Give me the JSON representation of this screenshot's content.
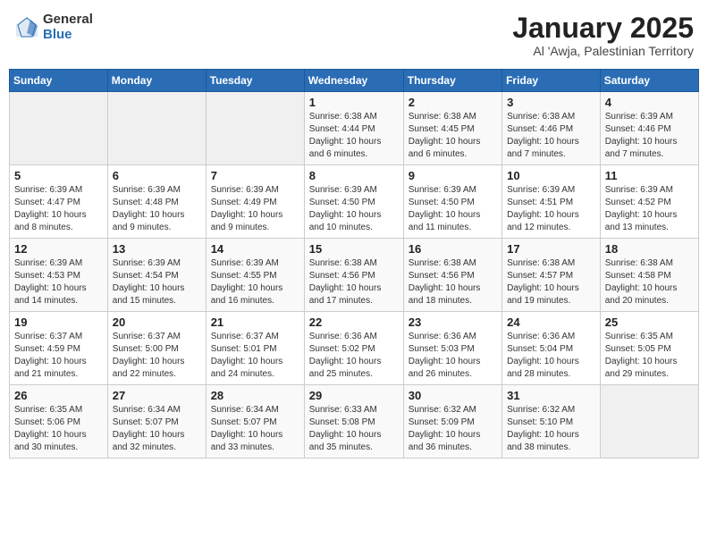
{
  "header": {
    "logo_general": "General",
    "logo_blue": "Blue",
    "month_title": "January 2025",
    "subtitle": "Al 'Awja, Palestinian Territory"
  },
  "weekdays": [
    "Sunday",
    "Monday",
    "Tuesday",
    "Wednesday",
    "Thursday",
    "Friday",
    "Saturday"
  ],
  "weeks": [
    [
      {
        "day": "",
        "info": ""
      },
      {
        "day": "",
        "info": ""
      },
      {
        "day": "",
        "info": ""
      },
      {
        "day": "1",
        "info": "Sunrise: 6:38 AM\nSunset: 4:44 PM\nDaylight: 10 hours\nand 6 minutes."
      },
      {
        "day": "2",
        "info": "Sunrise: 6:38 AM\nSunset: 4:45 PM\nDaylight: 10 hours\nand 6 minutes."
      },
      {
        "day": "3",
        "info": "Sunrise: 6:38 AM\nSunset: 4:46 PM\nDaylight: 10 hours\nand 7 minutes."
      },
      {
        "day": "4",
        "info": "Sunrise: 6:39 AM\nSunset: 4:46 PM\nDaylight: 10 hours\nand 7 minutes."
      }
    ],
    [
      {
        "day": "5",
        "info": "Sunrise: 6:39 AM\nSunset: 4:47 PM\nDaylight: 10 hours\nand 8 minutes."
      },
      {
        "day": "6",
        "info": "Sunrise: 6:39 AM\nSunset: 4:48 PM\nDaylight: 10 hours\nand 9 minutes."
      },
      {
        "day": "7",
        "info": "Sunrise: 6:39 AM\nSunset: 4:49 PM\nDaylight: 10 hours\nand 9 minutes."
      },
      {
        "day": "8",
        "info": "Sunrise: 6:39 AM\nSunset: 4:50 PM\nDaylight: 10 hours\nand 10 minutes."
      },
      {
        "day": "9",
        "info": "Sunrise: 6:39 AM\nSunset: 4:50 PM\nDaylight: 10 hours\nand 11 minutes."
      },
      {
        "day": "10",
        "info": "Sunrise: 6:39 AM\nSunset: 4:51 PM\nDaylight: 10 hours\nand 12 minutes."
      },
      {
        "day": "11",
        "info": "Sunrise: 6:39 AM\nSunset: 4:52 PM\nDaylight: 10 hours\nand 13 minutes."
      }
    ],
    [
      {
        "day": "12",
        "info": "Sunrise: 6:39 AM\nSunset: 4:53 PM\nDaylight: 10 hours\nand 14 minutes."
      },
      {
        "day": "13",
        "info": "Sunrise: 6:39 AM\nSunset: 4:54 PM\nDaylight: 10 hours\nand 15 minutes."
      },
      {
        "day": "14",
        "info": "Sunrise: 6:39 AM\nSunset: 4:55 PM\nDaylight: 10 hours\nand 16 minutes."
      },
      {
        "day": "15",
        "info": "Sunrise: 6:38 AM\nSunset: 4:56 PM\nDaylight: 10 hours\nand 17 minutes."
      },
      {
        "day": "16",
        "info": "Sunrise: 6:38 AM\nSunset: 4:56 PM\nDaylight: 10 hours\nand 18 minutes."
      },
      {
        "day": "17",
        "info": "Sunrise: 6:38 AM\nSunset: 4:57 PM\nDaylight: 10 hours\nand 19 minutes."
      },
      {
        "day": "18",
        "info": "Sunrise: 6:38 AM\nSunset: 4:58 PM\nDaylight: 10 hours\nand 20 minutes."
      }
    ],
    [
      {
        "day": "19",
        "info": "Sunrise: 6:37 AM\nSunset: 4:59 PM\nDaylight: 10 hours\nand 21 minutes."
      },
      {
        "day": "20",
        "info": "Sunrise: 6:37 AM\nSunset: 5:00 PM\nDaylight: 10 hours\nand 22 minutes."
      },
      {
        "day": "21",
        "info": "Sunrise: 6:37 AM\nSunset: 5:01 PM\nDaylight: 10 hours\nand 24 minutes."
      },
      {
        "day": "22",
        "info": "Sunrise: 6:36 AM\nSunset: 5:02 PM\nDaylight: 10 hours\nand 25 minutes."
      },
      {
        "day": "23",
        "info": "Sunrise: 6:36 AM\nSunset: 5:03 PM\nDaylight: 10 hours\nand 26 minutes."
      },
      {
        "day": "24",
        "info": "Sunrise: 6:36 AM\nSunset: 5:04 PM\nDaylight: 10 hours\nand 28 minutes."
      },
      {
        "day": "25",
        "info": "Sunrise: 6:35 AM\nSunset: 5:05 PM\nDaylight: 10 hours\nand 29 minutes."
      }
    ],
    [
      {
        "day": "26",
        "info": "Sunrise: 6:35 AM\nSunset: 5:06 PM\nDaylight: 10 hours\nand 30 minutes."
      },
      {
        "day": "27",
        "info": "Sunrise: 6:34 AM\nSunset: 5:07 PM\nDaylight: 10 hours\nand 32 minutes."
      },
      {
        "day": "28",
        "info": "Sunrise: 6:34 AM\nSunset: 5:07 PM\nDaylight: 10 hours\nand 33 minutes."
      },
      {
        "day": "29",
        "info": "Sunrise: 6:33 AM\nSunset: 5:08 PM\nDaylight: 10 hours\nand 35 minutes."
      },
      {
        "day": "30",
        "info": "Sunrise: 6:32 AM\nSunset: 5:09 PM\nDaylight: 10 hours\nand 36 minutes."
      },
      {
        "day": "31",
        "info": "Sunrise: 6:32 AM\nSunset: 5:10 PM\nDaylight: 10 hours\nand 38 minutes."
      },
      {
        "day": "",
        "info": ""
      }
    ]
  ]
}
